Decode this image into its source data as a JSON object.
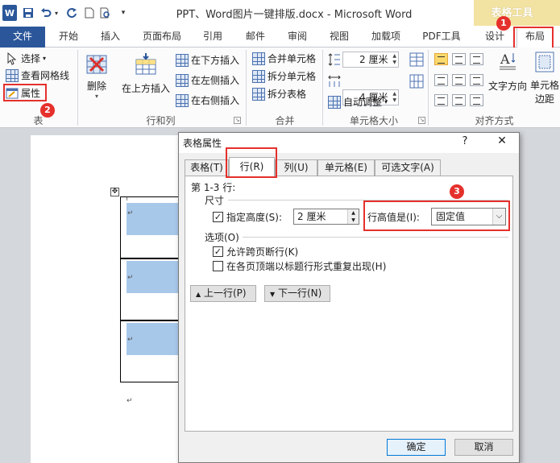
{
  "window": {
    "title": "PPT、Word图片一键排版.docx - Microsoft Word",
    "contextual_group": "表格工具",
    "app_icon": "W"
  },
  "tabs": [
    "文件",
    "开始",
    "插入",
    "页面布局",
    "引用",
    "邮件",
    "审阅",
    "视图",
    "加载项",
    "PDF工具",
    "设计",
    "布局"
  ],
  "ribbon": {
    "table_group": {
      "label": "表",
      "select": "选择",
      "gridlines": "查看网格线",
      "properties": "属性"
    },
    "rows_cols_group": {
      "label": "行和列",
      "delete": "删除",
      "insert_above": "在上方插入",
      "insert_below": "在下方插入",
      "insert_left": "在左侧插入",
      "insert_right": "在右侧插入"
    },
    "merge_group": {
      "label": "合并",
      "merge_cells": "合并单元格",
      "split_cells": "拆分单元格",
      "split_table": "拆分表格"
    },
    "cell_size_group": {
      "label": "单元格大小",
      "height": "2 厘米",
      "width": "4 厘米",
      "autofit": "自动调整"
    },
    "align_group": {
      "label": "对齐方式",
      "text_direction": "文字方向",
      "cell_margins_1": "单元格",
      "cell_margins_2": "边距"
    }
  },
  "dialog": {
    "title": "表格属性",
    "help": "?",
    "close": "✕",
    "tabs": [
      "表格(T)",
      "行(R)",
      "列(U)",
      "单元格(E)",
      "可选文字(A)"
    ],
    "rows_label": "第 1-3 行:",
    "size_section": "尺寸",
    "specify_height": "指定高度(S):",
    "height_value": "2 厘米",
    "row_height_is": "行高值是(I):",
    "row_height_mode": "固定值",
    "options_section": "选项(O)",
    "allow_break": "允许跨页断行(K)",
    "repeat_header": "在各页顶端以标题行形式重复出现(H)",
    "prev_row": "上一行(P)",
    "next_row": "下一行(N)",
    "ok": "确定",
    "cancel": "取消",
    "allow_break_checked": true,
    "specify_height_checked": true,
    "repeat_header_checked": false
  },
  "annotations": [
    "1",
    "2",
    "3"
  ],
  "paragraph_mark": "↵",
  "colors": {
    "accent": "#2b579a",
    "annotation_red": "#e5302c",
    "contextual": "#f3e3a2",
    "cell_fill": "#a8c8ea"
  }
}
